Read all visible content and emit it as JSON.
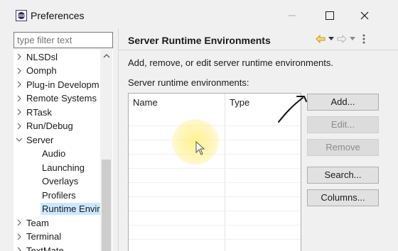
{
  "window": {
    "title": "Preferences",
    "icon": "eclipse-icon"
  },
  "filter": {
    "placeholder": "type filter text",
    "value": ""
  },
  "tree": {
    "items": [
      {
        "label": "NLSDsl",
        "expander": "collapsed",
        "level": 0
      },
      {
        "label": "Oomph",
        "expander": "collapsed",
        "level": 0
      },
      {
        "label": "Plug-in Developm",
        "expander": "collapsed",
        "level": 0
      },
      {
        "label": "Remote Systems",
        "expander": "collapsed",
        "level": 0
      },
      {
        "label": "RTask",
        "expander": "collapsed",
        "level": 0
      },
      {
        "label": "Run/Debug",
        "expander": "collapsed",
        "level": 0
      },
      {
        "label": "Server",
        "expander": "expanded",
        "level": 0
      },
      {
        "label": "Audio",
        "expander": "none",
        "level": 1
      },
      {
        "label": "Launching",
        "expander": "none",
        "level": 1
      },
      {
        "label": "Overlays",
        "expander": "none",
        "level": 1
      },
      {
        "label": "Profilers",
        "expander": "none",
        "level": 1
      },
      {
        "label": "Runtime Enviro",
        "expander": "none",
        "level": 1,
        "selected": true
      },
      {
        "label": "Team",
        "expander": "collapsed",
        "level": 0
      },
      {
        "label": "Terminal",
        "expander": "collapsed",
        "level": 0
      },
      {
        "label": "TextMate",
        "expander": "collapsed",
        "level": 0
      }
    ]
  },
  "page": {
    "title": "Server Runtime Environments",
    "description": "Add, remove, or edit server runtime environments.",
    "table_label": "Server runtime environments:"
  },
  "table": {
    "columns": [
      "Name",
      "Type"
    ],
    "rows": []
  },
  "buttons": {
    "add": "Add...",
    "edit": "Edit...",
    "remove": "Remove",
    "search": "Search...",
    "columns": "Columns..."
  },
  "colors": {
    "selection": "#cce8ff",
    "highlight": "#fff07a",
    "nav_back_active": "#e0a000"
  }
}
